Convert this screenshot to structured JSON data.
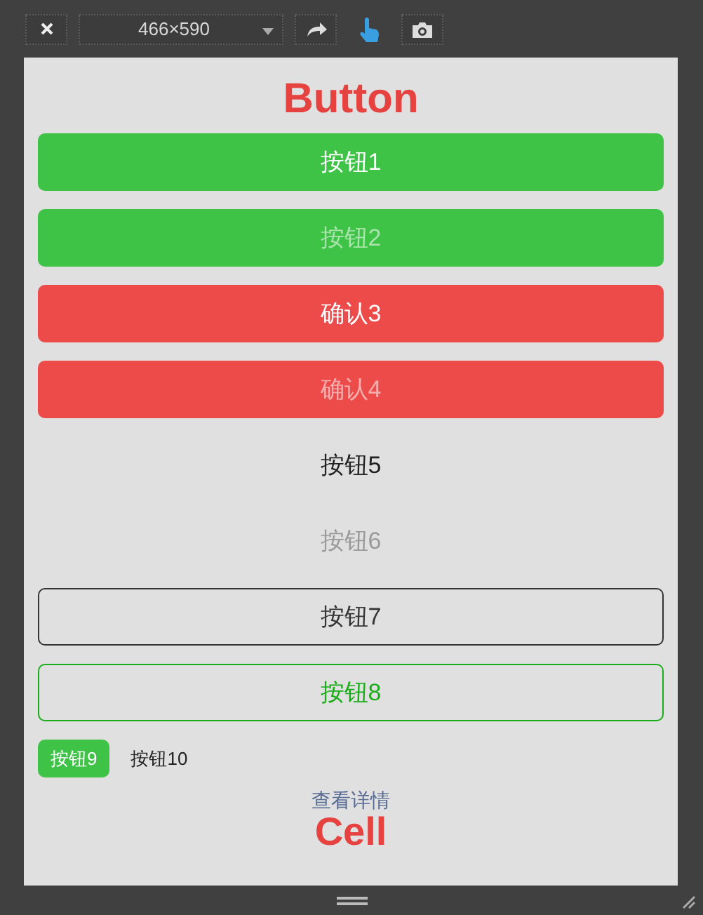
{
  "toolbar": {
    "device_size": "466×590",
    "touch_mode": {
      "on": true
    }
  },
  "page": {
    "title": "Button",
    "buttons": [
      {
        "kind": "primary",
        "label": "按钮1",
        "disabled": false
      },
      {
        "kind": "primary",
        "label": "按钮2",
        "disabled": true
      },
      {
        "kind": "warn",
        "label": "确认3",
        "disabled": false
      },
      {
        "kind": "warn",
        "label": "确认4",
        "disabled": true
      },
      {
        "kind": "default",
        "label": "按钮5",
        "disabled": false
      },
      {
        "kind": "default",
        "label": "按钮6",
        "disabled": true
      },
      {
        "kind": "plain",
        "label": "按钮7",
        "disabled": false
      },
      {
        "kind": "plain-primary",
        "label": "按钮8",
        "disabled": false
      }
    ],
    "mini_buttons": [
      {
        "kind": "primary",
        "label": "按钮9",
        "disabled": false
      },
      {
        "kind": "default",
        "label": "按钮10",
        "disabled": false
      }
    ],
    "link": "查看详情",
    "next_title": "Cell"
  }
}
